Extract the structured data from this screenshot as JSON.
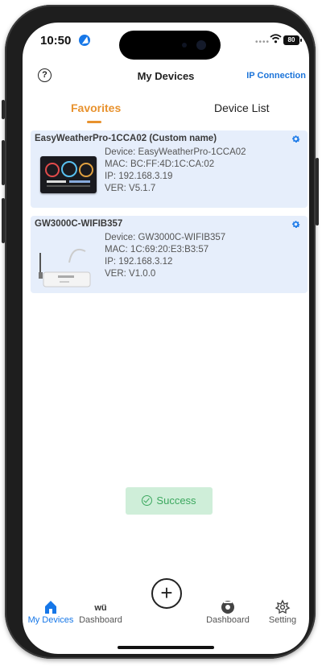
{
  "status_bar": {
    "time": "10:50",
    "battery": "80"
  },
  "header": {
    "title": "My Devices",
    "ip_connection": "IP Connection"
  },
  "tabs": {
    "favorites": "Favorites",
    "device_list": "Device List"
  },
  "devices": [
    {
      "title": "EasyWeatherPro-1CCA02 (Custom name)",
      "device": "Device: EasyWeatherPro-1CCA02",
      "mac": "MAC: BC:FF:4D:1C:CA:02",
      "ip": "IP: 192.168.3.19",
      "ver": "VER: V5.1.7"
    },
    {
      "title": "GW3000C-WIFIB357",
      "device": "Device: GW3000C-WIFIB357",
      "mac": "MAC: 1C:69:20:E3:B3:57",
      "ip": "IP: 192.168.3.12",
      "ver": "VER: V1.0.0"
    }
  ],
  "toast": {
    "text": "Success"
  },
  "tabbar": {
    "my_devices": "My Devices",
    "dashboard_1": "Dashboard",
    "dashboard_2": "Dashboard",
    "setting": "Setting"
  },
  "colors": {
    "accent_blue": "#1677e8",
    "accent_orange": "#e8922e",
    "card_bg": "#e6eefb",
    "toast_bg": "#cfeed9",
    "toast_text": "#3ca85f"
  }
}
